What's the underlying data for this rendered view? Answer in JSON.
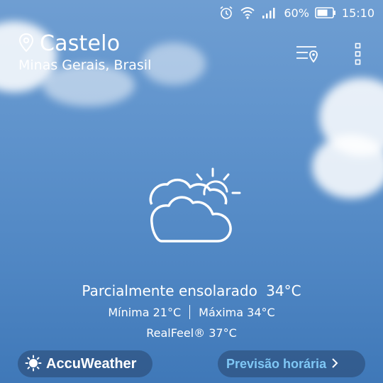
{
  "status_bar": {
    "battery_percent": "60%",
    "time": "15:10",
    "icons": [
      "alarm-icon",
      "wifi-icon",
      "signal-icon",
      "battery-icon"
    ]
  },
  "location": {
    "city": "Castelo",
    "region": "Minas Gerais, Brasil"
  },
  "actions": {
    "icons": [
      "location-list-icon",
      "more-options-icon"
    ]
  },
  "weather": {
    "icon": "partly-sunny-icon",
    "condition": "Parcialmente ensolarado",
    "temperature": "34°C",
    "min": "Mínima 21°C",
    "max": "Máxima 34°C",
    "realfeel": "RealFeel® 37°C"
  },
  "footer": {
    "brand": "AccuWeather",
    "forecast_label": "Previsão horária"
  },
  "colors": {
    "sky_top": "#6f9ed2",
    "sky_bottom": "#3f78b8",
    "accent": "#7fc7f5"
  }
}
